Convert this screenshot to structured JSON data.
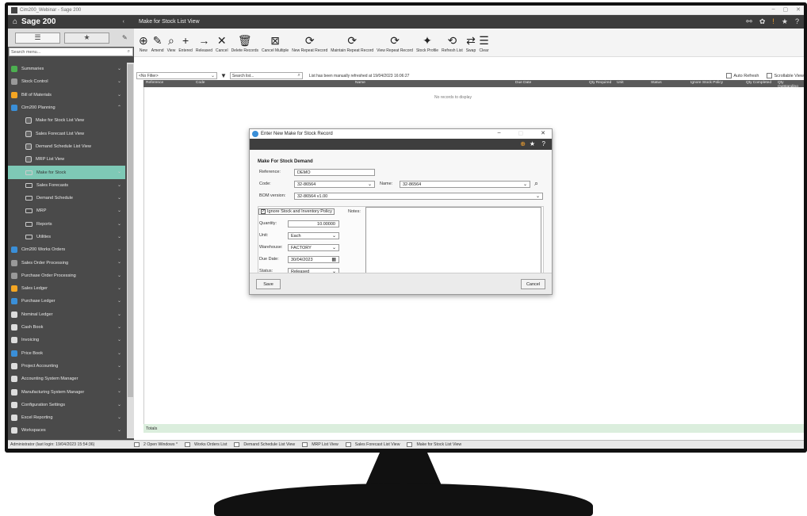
{
  "window": {
    "title": "Cim200_Webinar - Sage 200",
    "controls": [
      "–",
      "▢",
      "✕"
    ]
  },
  "header": {
    "brand": "Sage 200",
    "page_title": "Make for Stock List View"
  },
  "sidebar": {
    "search_placeholder": "Search menu...",
    "items": [
      {
        "label": "Summaries",
        "icon": "summaries-icon",
        "color": "#4caf50"
      },
      {
        "label": "Stock Control",
        "icon": "stock-control-icon",
        "color": "#999999"
      },
      {
        "label": "Bill of Materials",
        "icon": "bill-of-materials-icon",
        "color": "#f5a623"
      },
      {
        "label": "Cim200 Planning",
        "icon": "planning-icon",
        "color": "#3a8fd8"
      },
      {
        "label": "Make for Stock List View",
        "sub": true
      },
      {
        "label": "Sales Forecast List View",
        "sub": true
      },
      {
        "label": "Demand Schedule List View",
        "sub": true
      },
      {
        "label": "MRP List View",
        "sub": true
      },
      {
        "label": "Make for Stock",
        "sub": true,
        "folder": true,
        "active": true
      },
      {
        "label": "Sales Forecasts",
        "sub": true,
        "folder": true
      },
      {
        "label": "Demand Schedule",
        "sub": true,
        "folder": true
      },
      {
        "label": "MRP",
        "sub": true,
        "folder": true
      },
      {
        "label": "Reports",
        "sub": true,
        "folder": true
      },
      {
        "label": "Utilities",
        "sub": true,
        "folder": true
      },
      {
        "label": "Cim200 Works Orders",
        "icon": "works-orders-icon",
        "color": "#3a8fd8"
      },
      {
        "label": "Sales Order Processing",
        "icon": "sales-order-icon",
        "color": "#999999"
      },
      {
        "label": "Purchase Order Processing",
        "icon": "purchase-order-icon",
        "color": "#999999"
      },
      {
        "label": "Sales Ledger",
        "icon": "sales-ledger-icon",
        "color": "#f5a623"
      },
      {
        "label": "Purchase Ledger",
        "icon": "purchase-ledger-icon",
        "color": "#3a8fd8"
      },
      {
        "label": "Nominal Ledger",
        "icon": "nominal-ledger-icon",
        "color": "#dddddd"
      },
      {
        "label": "Cash Book",
        "icon": "cash-book-icon",
        "color": "#dddddd"
      },
      {
        "label": "Invoicing",
        "icon": "invoicing-icon",
        "color": "#dddddd"
      },
      {
        "label": "Price Book",
        "icon": "price-book-icon",
        "color": "#3a8fd8"
      },
      {
        "label": "Project Accounting",
        "icon": "project-accounting-icon",
        "color": "#dddddd"
      },
      {
        "label": "Accounting System Manager",
        "icon": "accounting-manager-icon",
        "color": "#dddddd"
      },
      {
        "label": "Manufacturing System Manager",
        "icon": "manufacturing-manager-icon",
        "color": "#dddddd"
      },
      {
        "label": "Configuration Settings",
        "icon": "configuration-icon",
        "color": "#dddddd"
      },
      {
        "label": "Excel Reporting",
        "icon": "excel-reporting-icon",
        "color": "#dddddd"
      },
      {
        "label": "Workspaces",
        "icon": "workspaces-icon",
        "color": "#dddddd"
      }
    ]
  },
  "toolbar": {
    "buttons": [
      {
        "label": "New",
        "glyph": "⊕",
        "icon": "new-icon"
      },
      {
        "label": "Amend",
        "glyph": "✎",
        "icon": "amend-icon"
      },
      {
        "label": "View",
        "glyph": "⌕",
        "icon": "view-icon"
      },
      {
        "label": "Entered",
        "glyph": "+",
        "icon": "entered-icon"
      },
      {
        "label": "Released",
        "glyph": "→",
        "icon": "released-icon"
      },
      {
        "label": "Cancel",
        "glyph": "✕",
        "icon": "cancel-icon"
      },
      {
        "label": "Delete Records",
        "glyph": "🗑",
        "icon": "delete-icon"
      },
      {
        "label": "Cancel Multiple",
        "glyph": "⊠",
        "icon": "cancel-multiple-icon"
      },
      {
        "label": "New Repeat Record",
        "glyph": "⟳",
        "icon": "new-repeat-icon"
      },
      {
        "label": "Maintain Repeat Record",
        "glyph": "⟳",
        "icon": "maintain-repeat-icon"
      },
      {
        "label": "View Repeat Record",
        "glyph": "⟳",
        "icon": "view-repeat-icon"
      },
      {
        "label": "Stock Profile",
        "glyph": "✦",
        "icon": "stock-profile-icon"
      },
      {
        "label": "Refresh List",
        "glyph": "⟲",
        "icon": "refresh-icon"
      },
      {
        "label": "Swap",
        "glyph": "⇄",
        "icon": "swap-icon"
      },
      {
        "label": "Clear",
        "glyph": "☰",
        "icon": "clear-icon"
      }
    ]
  },
  "list": {
    "filter_select": "<No Filter>",
    "search_placeholder": "Search list...",
    "refresh_message": "List has been manually refreshed at 19/04/2023 16:06:27",
    "auto_refresh_label": "Auto Refresh",
    "scrollable_view_label": "Scrollable View",
    "columns": [
      "Reference",
      "Code",
      "Name",
      "Due Date",
      "Qty Required",
      "Unit",
      "Status",
      "Ignore Stock Policy",
      "Qty Completed",
      "Qty Outstanding"
    ],
    "empty_message": "No records to display",
    "totals_label": "Totals"
  },
  "statusbar": {
    "user": "Administrator (last login: 19/04/2023 15:54:36)",
    "items": [
      "2 Open Windows *",
      "Works Orders List",
      "Demand Schedule List View",
      "MRP List View",
      "Sales Forecast List View",
      "Make for Stock List View"
    ]
  },
  "dialog": {
    "title": "Enter New Make for Stock Record",
    "section": "Make For Stock Demand",
    "reference_label": "Reference:",
    "reference_value": "DEMO",
    "code_label": "Code:",
    "code_value": "32-86564",
    "name_label": "Name:",
    "name_value": "32-86564",
    "bom_label": "BOM version:",
    "bom_value": "32-86564 v1.00",
    "ignore_label": "Ignore Stock and Inventory Policy",
    "notes_label": "Notes:",
    "quantity_label": "Quantity:",
    "quantity_value": "10.00000",
    "unit_label": "Unit:",
    "unit_value": "Each",
    "warehouse_label": "Warehouse:",
    "warehouse_value": "FACTORY",
    "due_label": "Due Date:",
    "due_value": "30/04/2023",
    "status_label": "Status:",
    "status_value": "Released",
    "save_label": "Save",
    "cancel_label": "Cancel"
  },
  "colors": {
    "accent_teal": "#7ec9b6",
    "header_dark": "#3c3c3c",
    "sidebar": "#4a4a4a",
    "totals_bg": "#dbeedd"
  }
}
